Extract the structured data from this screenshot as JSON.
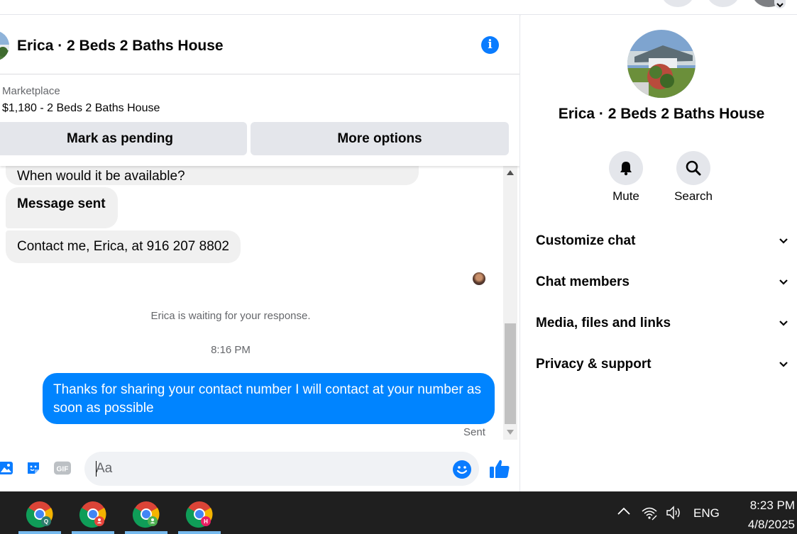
{
  "chat": {
    "title": "Erica · 2 Beds 2 Baths House",
    "marketplace_label": "Marketplace",
    "listing": "$1,180 - 2 Beds 2 Baths House",
    "buttons": {
      "pending": "Mark as pending",
      "more": "More options"
    },
    "messages": [
      {
        "text": "When would it be available?"
      },
      {
        "text": "Message sent"
      },
      {
        "text": "Contact me, Erica, at 916 207 8802"
      }
    ],
    "waiting_notice": "Erica is waiting for your response.",
    "timestamp": "8:16 PM",
    "outgoing": "Thanks for sharing your contact number I will contact at your number as soon as possible",
    "status": "Sent",
    "composer_placeholder": "Aa"
  },
  "sidebar": {
    "title": "Erica · 2 Beds 2 Baths House",
    "actions": {
      "mute": "Mute",
      "search": "Search"
    },
    "sections": [
      "Customize chat",
      "Chat members",
      "Media, files and links",
      "Privacy & support"
    ]
  },
  "taskbar": {
    "language": "ENG",
    "time": "8:23 PM",
    "date": "4/8/2025",
    "apps": [
      {
        "icon": "chrome-icon",
        "badge": "Q",
        "badge_color": "#2e7d6e"
      },
      {
        "icon": "chrome-icon",
        "badge": "person",
        "badge_color": "#e8453c"
      },
      {
        "icon": "chrome-icon",
        "badge": "person",
        "badge_color": "#4caf50"
      },
      {
        "icon": "chrome-icon",
        "badge": "H",
        "badge_color": "#e91e63"
      }
    ]
  },
  "colors": {
    "accent": "#0084ff",
    "info": "#0a7cff",
    "taskbar": "#1f1f1f"
  }
}
